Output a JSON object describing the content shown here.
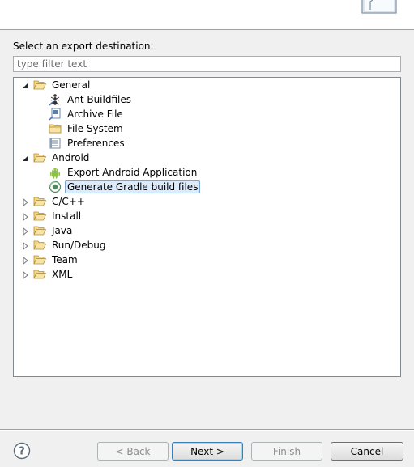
{
  "prompt_label": "Select an export destination:",
  "filter": {
    "placeholder": "type filter text",
    "value": ""
  },
  "tree": {
    "general": {
      "label": "General",
      "children": [
        "Ant Buildfiles",
        "Archive File",
        "File System",
        "Preferences"
      ]
    },
    "android": {
      "label": "Android",
      "children": [
        "Export Android Application",
        "Generate Gradle build files"
      ]
    },
    "collapsed": [
      "C/C++",
      "Install",
      "Java",
      "Run/Debug",
      "Team",
      "XML"
    ]
  },
  "buttons": {
    "back": "< Back",
    "next": "Next >",
    "finish": "Finish",
    "cancel": "Cancel"
  },
  "icons": {
    "folder": "folder-open-icon",
    "ant": "ant-icon",
    "archive": "archive-icon",
    "filesystem": "folder-icon",
    "preferences": "preferences-icon",
    "android": "android-icon",
    "gradle": "gradle-icon",
    "help": "help-icon"
  },
  "colors": {
    "selection": "#dcebfc",
    "selection_border": "#7da2ce",
    "android_green": "#8ac43f",
    "folder_yellow": "#e8c565"
  }
}
